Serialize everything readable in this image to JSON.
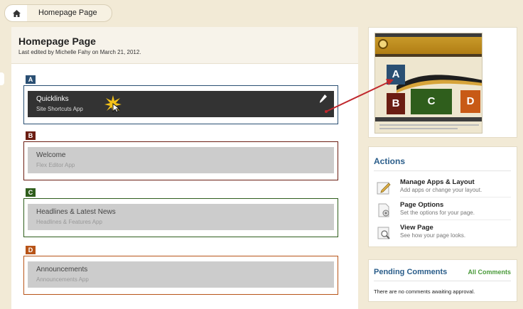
{
  "breadcrumb": {
    "home_icon": "home-icon",
    "page_label": "Homepage Page"
  },
  "page": {
    "title": "Homepage Page",
    "meta": "Last edited by Michelle Fahy on March 21, 2012."
  },
  "zones": [
    {
      "tag": "A",
      "color": "#2a4f73",
      "app_title": "Quicklinks",
      "app_subtitle": "Site Shortcuts App",
      "bar_color": "#333333"
    },
    {
      "tag": "B",
      "color": "#6b1d12",
      "app_title": "Welcome",
      "app_subtitle": "Flex Editor App",
      "bar_color": "#cccccc"
    },
    {
      "tag": "C",
      "color": "#2f5e1c",
      "app_title": "Headlines & Latest News",
      "app_subtitle": "Headlines & Features App",
      "bar_color": "#cccccc"
    },
    {
      "tag": "D",
      "color": "#b85418",
      "app_title": "Announcements",
      "app_subtitle": "Announcements App",
      "bar_color": "#cccccc"
    }
  ],
  "thumbnail": {
    "boxes": [
      "A",
      "B",
      "C",
      "D"
    ]
  },
  "actions": {
    "title": "Actions",
    "items": [
      {
        "name": "Manage Apps & Layout",
        "desc": "Add apps or change your layout.",
        "icon": "edit-layout-icon"
      },
      {
        "name": "Page Options",
        "desc": "Set the options for your page.",
        "icon": "page-options-icon"
      },
      {
        "name": "View Page",
        "desc": "See how your page looks.",
        "icon": "view-page-icon"
      }
    ]
  },
  "pending": {
    "title": "Pending Comments",
    "link": "All Comments",
    "text": "There are no comments awaiting approval."
  }
}
